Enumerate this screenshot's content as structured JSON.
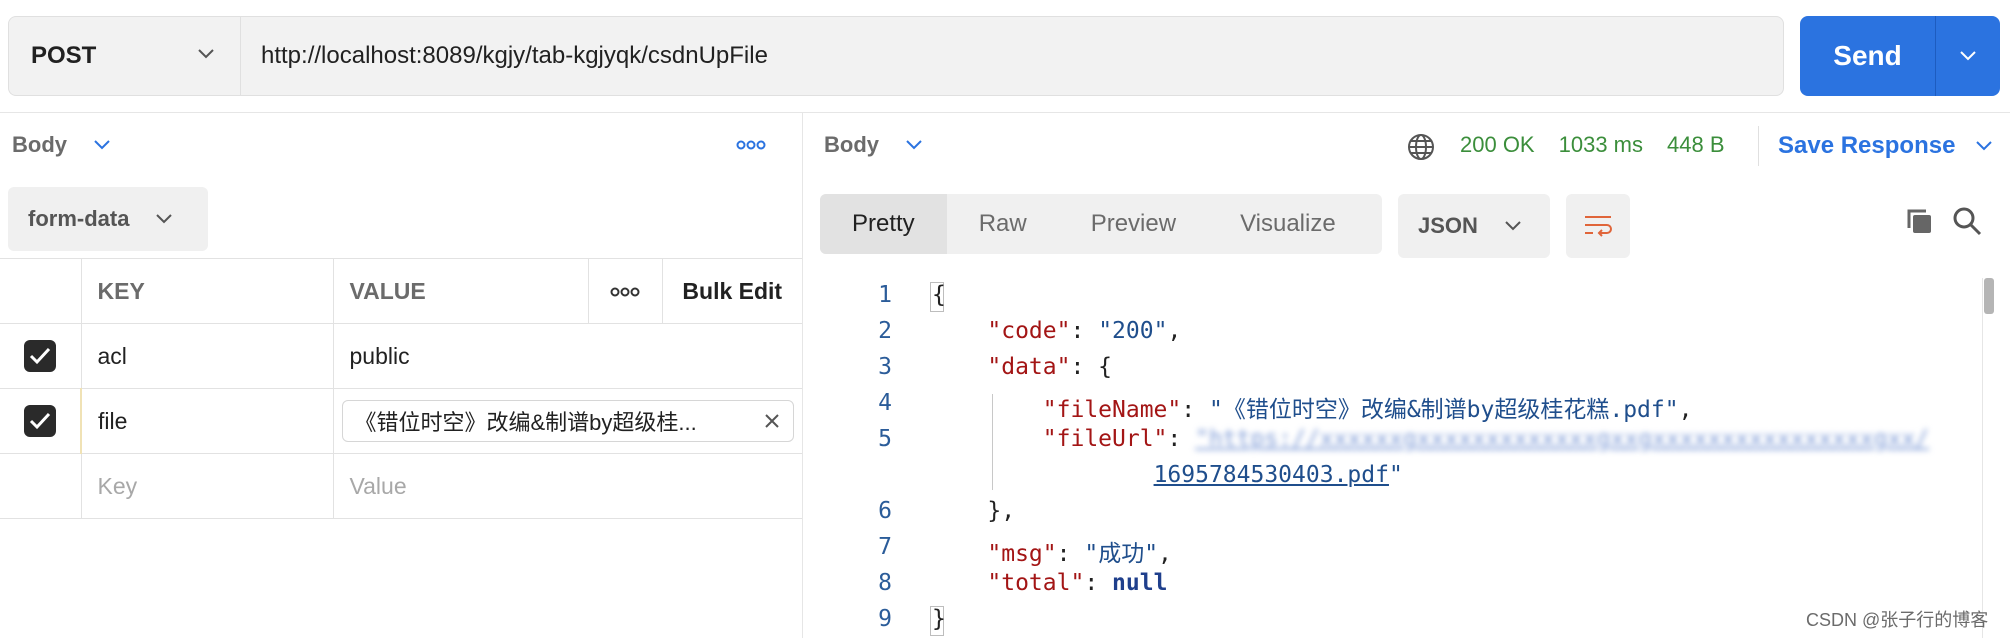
{
  "request": {
    "method": "POST",
    "url": "http://localhost:8089/kgjy/tab-kgjyqk/csdnUpFile",
    "send_label": "Send"
  },
  "left": {
    "body_label": "Body",
    "body_type": "form-data",
    "columns": {
      "key": "KEY",
      "value": "VALUE",
      "bulk_edit": "Bulk Edit"
    },
    "rows": [
      {
        "checked": true,
        "key": "acl",
        "value": "public"
      },
      {
        "checked": true,
        "key": "file",
        "value": "《错位时空》改编&制谱by超级桂..."
      }
    ],
    "empty_row": {
      "key_placeholder": "Key",
      "value_placeholder": "Value"
    }
  },
  "right": {
    "body_label": "Body",
    "status": "200 OK",
    "time": "1033 ms",
    "size": "448 B",
    "save_label": "Save Response",
    "tabs": [
      "Pretty",
      "Raw",
      "Preview",
      "Visualize"
    ],
    "active_tab": "Pretty",
    "format": "JSON"
  },
  "code": {
    "line_numbers": [
      "1",
      "2",
      "3",
      "4",
      "5",
      "",
      "6",
      "7",
      "8",
      "9"
    ],
    "code_value": "\"200\"",
    "file_name": "\"《错位时空》改编&制谱by超级桂花糕.pdf\"",
    "file_url_blurred": "\"https://xxxxxxgxxxxxxxxxxxxxgxxgxxxxxxxxxxxxxxxxgxx/",
    "file_url_tail": "1695784530403.pdf",
    "msg_value": "\"成功\"",
    "total_value": "null"
  },
  "watermark": "CSDN @张子行的博客",
  "colors": {
    "accent": "#2b73e0",
    "ok": "#3b8e3b",
    "key": "#a31515",
    "string": "#1f4e8c"
  },
  "icons": [
    "chevron-down-icon",
    "more-dots-icon",
    "check-icon",
    "close-icon",
    "globe-icon",
    "wrap-lines-icon",
    "copy-icon",
    "search-icon"
  ]
}
